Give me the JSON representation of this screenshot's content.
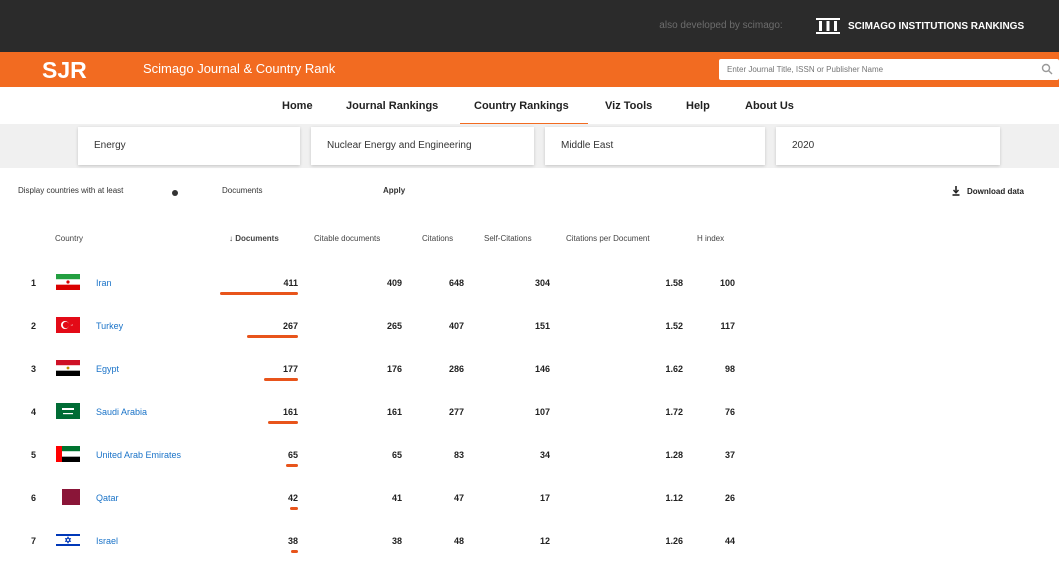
{
  "topbar": {
    "developed_by": "also developed by scimago:",
    "sir_label": "SCIMAGO INSTITUTIONS RANKINGS"
  },
  "header": {
    "logo": "SJR",
    "title": "Scimago Journal & Country Rank",
    "search_placeholder": "Enter Journal Title, ISSN or Publisher Name"
  },
  "nav": {
    "items": [
      "Home",
      "Journal Rankings",
      "Country Rankings",
      "Viz Tools",
      "Help",
      "About Us"
    ],
    "active": "Country Rankings"
  },
  "filters": {
    "subject_area": "Energy",
    "subject_category": "Nuclear Energy and Engineering",
    "region": "Middle East",
    "year": "2020"
  },
  "options": {
    "display_label": "Display countries with at least",
    "documents_label": "Documents",
    "apply_label": "Apply",
    "download_label": "Download data"
  },
  "table": {
    "headers": [
      "Country",
      "Documents",
      "Citable documents",
      "Citations",
      "Self-Citations",
      "Citations per Document",
      "H index"
    ],
    "sorted_column": "Documents",
    "rows": [
      {
        "rank": "1",
        "country": "Iran",
        "documents": "411",
        "citable": "409",
        "citations": "648",
        "self": "304",
        "cpd": "1.58",
        "h": "100",
        "bar_fraction": 1.0
      },
      {
        "rank": "2",
        "country": "Turkey",
        "documents": "267",
        "citable": "265",
        "citations": "407",
        "self": "151",
        "cpd": "1.52",
        "h": "117",
        "bar_fraction": 0.65
      },
      {
        "rank": "3",
        "country": "Egypt",
        "documents": "177",
        "citable": "176",
        "citations": "286",
        "self": "146",
        "cpd": "1.62",
        "h": "98",
        "bar_fraction": 0.43
      },
      {
        "rank": "4",
        "country": "Saudi Arabia",
        "documents": "161",
        "citable": "161",
        "citations": "277",
        "self": "107",
        "cpd": "1.72",
        "h": "76",
        "bar_fraction": 0.39
      },
      {
        "rank": "5",
        "country": "United Arab Emirates",
        "documents": "65",
        "citable": "65",
        "citations": "83",
        "self": "34",
        "cpd": "1.28",
        "h": "37",
        "bar_fraction": 0.16
      },
      {
        "rank": "6",
        "country": "Qatar",
        "documents": "42",
        "citable": "41",
        "citations": "47",
        "self": "17",
        "cpd": "1.12",
        "h": "26",
        "bar_fraction": 0.1
      },
      {
        "rank": "7",
        "country": "Israel",
        "documents": "38",
        "citable": "38",
        "citations": "48",
        "self": "12",
        "cpd": "1.26",
        "h": "44",
        "bar_fraction": 0.09
      }
    ]
  },
  "colors": {
    "accent": "#f26b21",
    "topbar": "#2b2b2b",
    "link": "#1a73c8"
  },
  "icons": [
    "search-icon",
    "info-icon",
    "download-icon",
    "sir-columns-icon"
  ]
}
